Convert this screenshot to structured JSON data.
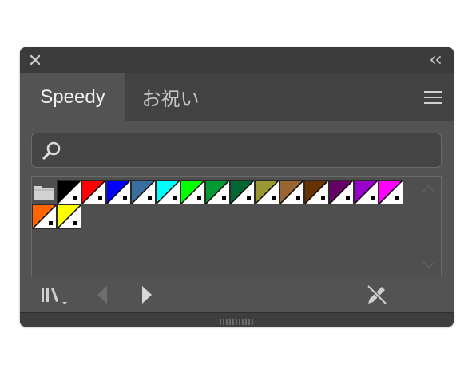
{
  "titlebar": {
    "close_icon": "close-icon",
    "collapse_icon": "double-chevron-left-icon"
  },
  "tabs": [
    {
      "label": "Speedy",
      "active": true
    },
    {
      "label": "お祝い",
      "active": false
    }
  ],
  "menu_icon": "hamburger-menu-icon",
  "search": {
    "value": "",
    "placeholder": "",
    "icon": "search-icon"
  },
  "swatches": {
    "folder_icon": "folder-icon",
    "colors": [
      "#000000",
      "#ff0000",
      "#0000ff",
      "#3a6e9e",
      "#00ffff",
      "#00ff00",
      "#009933",
      "#006633",
      "#999933",
      "#996633",
      "#663300",
      "#660066",
      "#9900cc",
      "#ff00ff",
      "#ff6600",
      "#ffff00"
    ]
  },
  "footer": {
    "library_icon": "swatch-libraries-icon",
    "prev_icon": "previous-arrow-icon",
    "next_icon": "next-arrow-icon",
    "edit_icon": "no-edit-pencil-icon"
  },
  "colors": {
    "panel_bg": "#535353",
    "titlebar_bg": "#3b3b3b",
    "tab_active_bg": "#535353",
    "tabbar_bg": "#424242",
    "text_active": "#f0f0f0",
    "text_inactive": "#c4c4c4"
  }
}
